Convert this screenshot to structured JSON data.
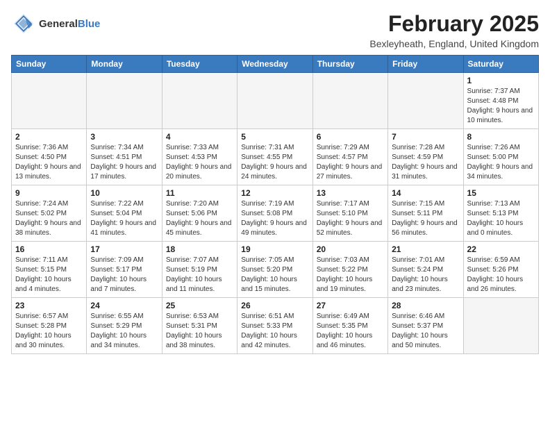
{
  "header": {
    "logo_general": "General",
    "logo_blue": "Blue",
    "month_title": "February 2025",
    "location": "Bexleyheath, England, United Kingdom"
  },
  "calendar": {
    "days_of_week": [
      "Sunday",
      "Monday",
      "Tuesday",
      "Wednesday",
      "Thursday",
      "Friday",
      "Saturday"
    ],
    "weeks": [
      [
        {
          "day": "",
          "detail": ""
        },
        {
          "day": "",
          "detail": ""
        },
        {
          "day": "",
          "detail": ""
        },
        {
          "day": "",
          "detail": ""
        },
        {
          "day": "",
          "detail": ""
        },
        {
          "day": "",
          "detail": ""
        },
        {
          "day": "1",
          "detail": "Sunrise: 7:37 AM\nSunset: 4:48 PM\nDaylight: 9 hours and 10 minutes."
        }
      ],
      [
        {
          "day": "2",
          "detail": "Sunrise: 7:36 AM\nSunset: 4:50 PM\nDaylight: 9 hours and 13 minutes."
        },
        {
          "day": "3",
          "detail": "Sunrise: 7:34 AM\nSunset: 4:51 PM\nDaylight: 9 hours and 17 minutes."
        },
        {
          "day": "4",
          "detail": "Sunrise: 7:33 AM\nSunset: 4:53 PM\nDaylight: 9 hours and 20 minutes."
        },
        {
          "day": "5",
          "detail": "Sunrise: 7:31 AM\nSunset: 4:55 PM\nDaylight: 9 hours and 24 minutes."
        },
        {
          "day": "6",
          "detail": "Sunrise: 7:29 AM\nSunset: 4:57 PM\nDaylight: 9 hours and 27 minutes."
        },
        {
          "day": "7",
          "detail": "Sunrise: 7:28 AM\nSunset: 4:59 PM\nDaylight: 9 hours and 31 minutes."
        },
        {
          "day": "8",
          "detail": "Sunrise: 7:26 AM\nSunset: 5:00 PM\nDaylight: 9 hours and 34 minutes."
        }
      ],
      [
        {
          "day": "9",
          "detail": "Sunrise: 7:24 AM\nSunset: 5:02 PM\nDaylight: 9 hours and 38 minutes."
        },
        {
          "day": "10",
          "detail": "Sunrise: 7:22 AM\nSunset: 5:04 PM\nDaylight: 9 hours and 41 minutes."
        },
        {
          "day": "11",
          "detail": "Sunrise: 7:20 AM\nSunset: 5:06 PM\nDaylight: 9 hours and 45 minutes."
        },
        {
          "day": "12",
          "detail": "Sunrise: 7:19 AM\nSunset: 5:08 PM\nDaylight: 9 hours and 49 minutes."
        },
        {
          "day": "13",
          "detail": "Sunrise: 7:17 AM\nSunset: 5:10 PM\nDaylight: 9 hours and 52 minutes."
        },
        {
          "day": "14",
          "detail": "Sunrise: 7:15 AM\nSunset: 5:11 PM\nDaylight: 9 hours and 56 minutes."
        },
        {
          "day": "15",
          "detail": "Sunrise: 7:13 AM\nSunset: 5:13 PM\nDaylight: 10 hours and 0 minutes."
        }
      ],
      [
        {
          "day": "16",
          "detail": "Sunrise: 7:11 AM\nSunset: 5:15 PM\nDaylight: 10 hours and 4 minutes."
        },
        {
          "day": "17",
          "detail": "Sunrise: 7:09 AM\nSunset: 5:17 PM\nDaylight: 10 hours and 7 minutes."
        },
        {
          "day": "18",
          "detail": "Sunrise: 7:07 AM\nSunset: 5:19 PM\nDaylight: 10 hours and 11 minutes."
        },
        {
          "day": "19",
          "detail": "Sunrise: 7:05 AM\nSunset: 5:20 PM\nDaylight: 10 hours and 15 minutes."
        },
        {
          "day": "20",
          "detail": "Sunrise: 7:03 AM\nSunset: 5:22 PM\nDaylight: 10 hours and 19 minutes."
        },
        {
          "day": "21",
          "detail": "Sunrise: 7:01 AM\nSunset: 5:24 PM\nDaylight: 10 hours and 23 minutes."
        },
        {
          "day": "22",
          "detail": "Sunrise: 6:59 AM\nSunset: 5:26 PM\nDaylight: 10 hours and 26 minutes."
        }
      ],
      [
        {
          "day": "23",
          "detail": "Sunrise: 6:57 AM\nSunset: 5:28 PM\nDaylight: 10 hours and 30 minutes."
        },
        {
          "day": "24",
          "detail": "Sunrise: 6:55 AM\nSunset: 5:29 PM\nDaylight: 10 hours and 34 minutes."
        },
        {
          "day": "25",
          "detail": "Sunrise: 6:53 AM\nSunset: 5:31 PM\nDaylight: 10 hours and 38 minutes."
        },
        {
          "day": "26",
          "detail": "Sunrise: 6:51 AM\nSunset: 5:33 PM\nDaylight: 10 hours and 42 minutes."
        },
        {
          "day": "27",
          "detail": "Sunrise: 6:49 AM\nSunset: 5:35 PM\nDaylight: 10 hours and 46 minutes."
        },
        {
          "day": "28",
          "detail": "Sunrise: 6:46 AM\nSunset: 5:37 PM\nDaylight: 10 hours and 50 minutes."
        },
        {
          "day": "",
          "detail": ""
        }
      ]
    ]
  }
}
